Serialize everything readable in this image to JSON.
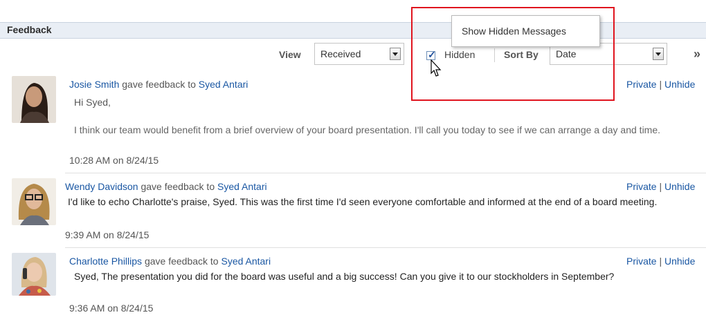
{
  "panel": {
    "title": "Feedback"
  },
  "toolbar": {
    "view_label": "View",
    "view_value": "Received",
    "hidden_label": "Hidden",
    "hidden_checked": true,
    "sortby_label": "Sort By",
    "sortby_value": "Date",
    "more_glyph": "»"
  },
  "tooltip": {
    "text": "Show Hidden Messages"
  },
  "feedback": [
    {
      "author": "Josie Smith",
      "verb": "gave feedback to",
      "recipient": "Syed Antari",
      "greeting": "Hi Syed,",
      "message": "I think our team would benefit from a brief overview of your board presentation. I'll call you today to see if we can arrange a day and time.",
      "time": "10:28 AM on 8/24/15",
      "private": "Private",
      "separator": "|",
      "unhide": "Unhide"
    },
    {
      "author": "Wendy Davidson",
      "verb": "gave feedback to",
      "recipient": "Syed Antari",
      "message": "I'd like to echo Charlotte's praise, Syed. This was the first time I'd seen everyone comfortable and informed at the end of a board meeting.",
      "time": "9:39 AM on 8/24/15",
      "private": "Private",
      "separator": "|",
      "unhide": "Unhide"
    },
    {
      "author": "Charlotte Phillips",
      "verb": "gave feedback to",
      "recipient": "Syed Antari",
      "message": "Syed, The presentation you did for the board was useful and a big success! Can you give it to our stockholders in September?",
      "time": "9:36 AM on 8/24/15",
      "private": "Private",
      "separator": "|",
      "unhide": "Unhide"
    }
  ],
  "colors": {
    "link": "#1a57a3",
    "highlight": "#e0141e",
    "header_bg": "#e9eef5"
  }
}
